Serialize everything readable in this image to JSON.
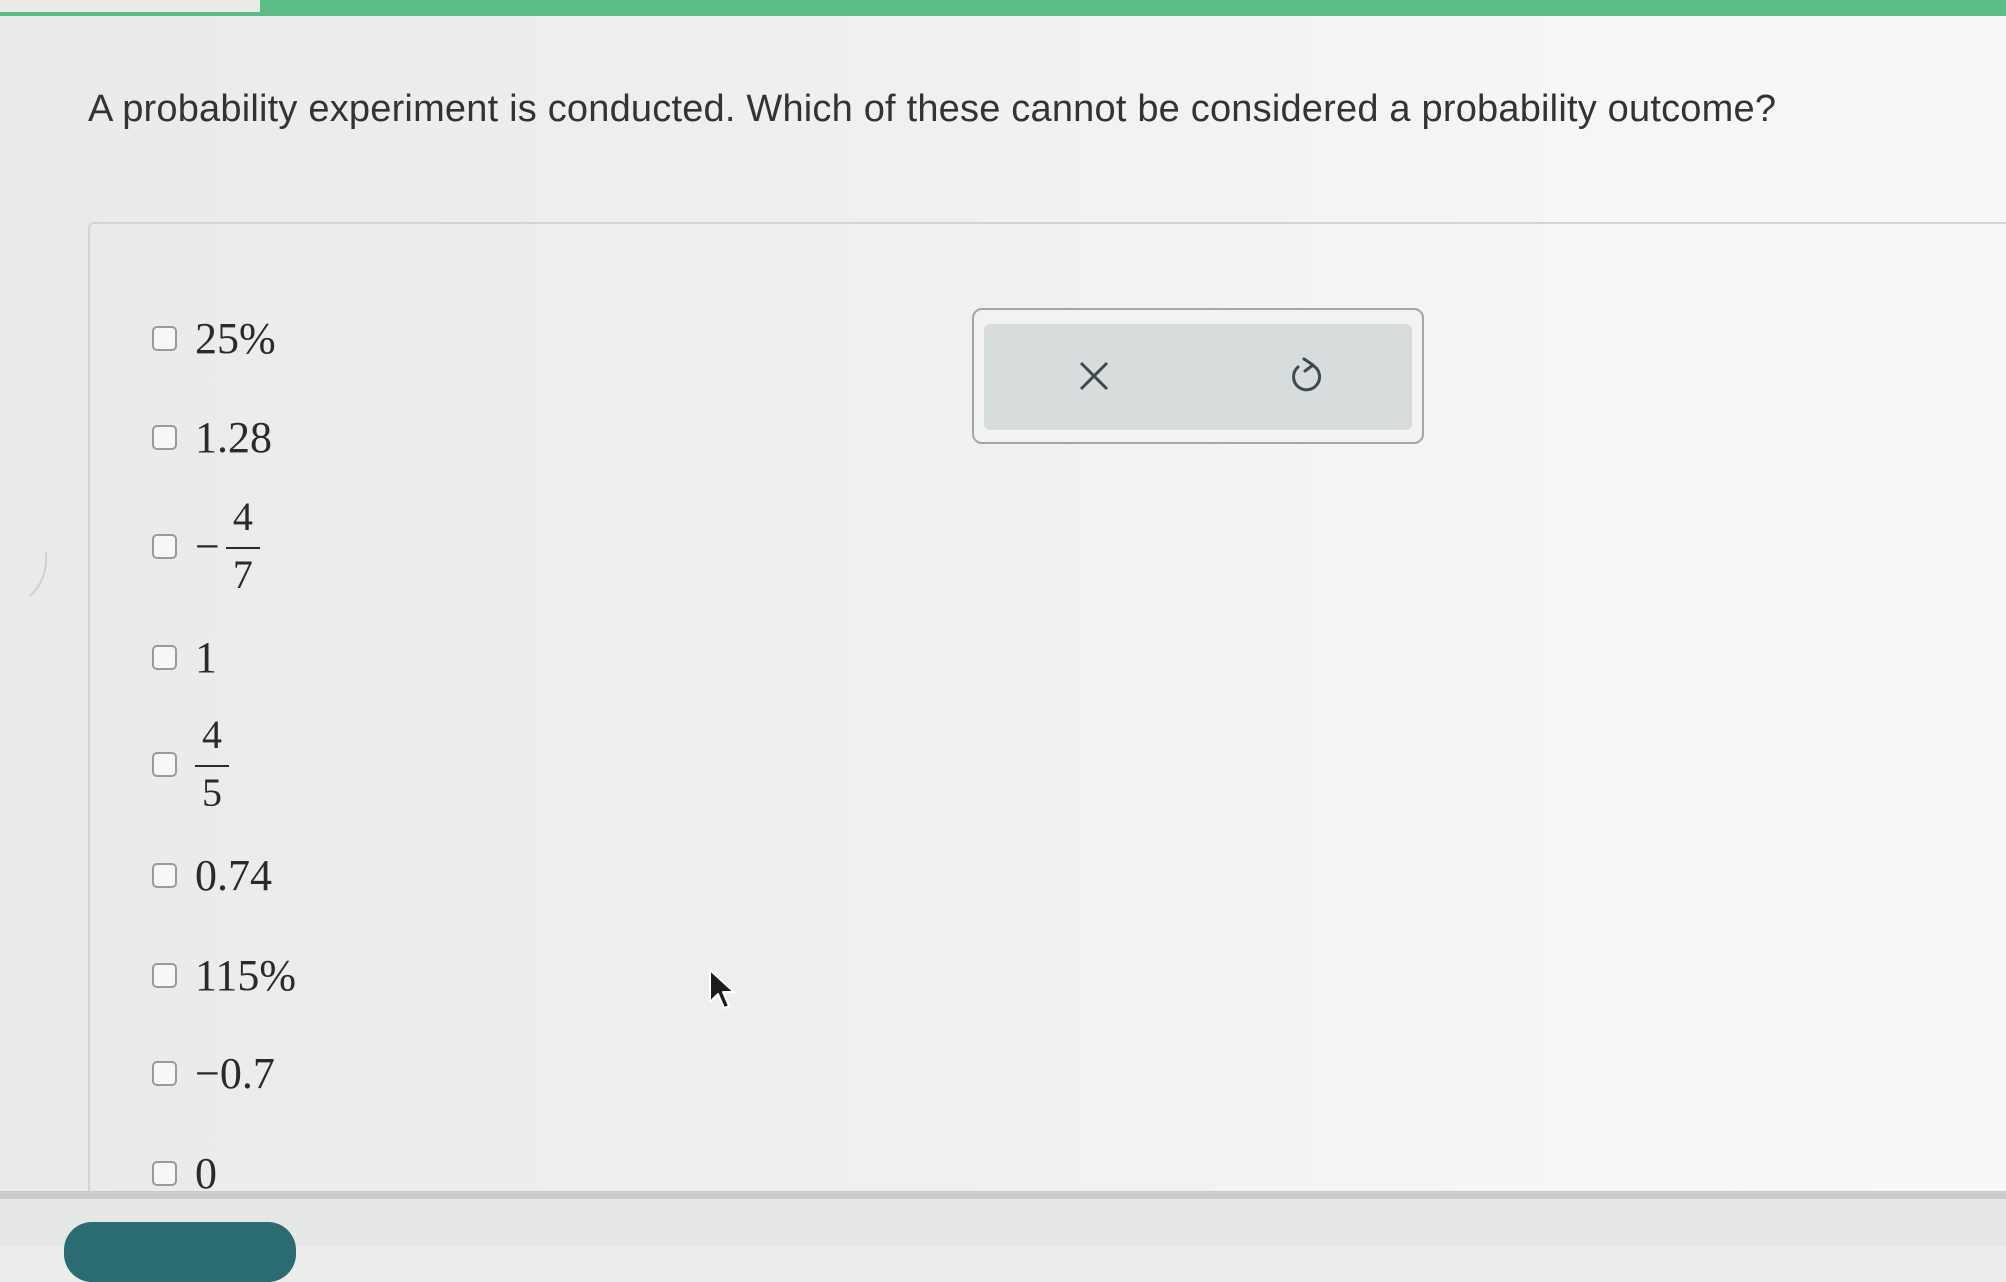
{
  "question": {
    "text": "A probability experiment is conducted. Which of these cannot be considered a probability outcome?"
  },
  "choices": [
    {
      "label": "25%",
      "checked": false
    },
    {
      "label": "1.28",
      "checked": false
    },
    {
      "sign": "−",
      "numerator": "4",
      "denominator": "7",
      "checked": false
    },
    {
      "label": "1",
      "checked": false
    },
    {
      "sign": "",
      "numerator": "4",
      "denominator": "5",
      "checked": false
    },
    {
      "label": "0.74",
      "checked": false
    },
    {
      "label": "115%",
      "checked": false
    },
    {
      "label": "−0.7",
      "checked": false
    },
    {
      "label": "0",
      "checked": false
    }
  ],
  "toolbar": {
    "clear_icon": "close-icon",
    "undo_icon": "undo-icon"
  },
  "colors": {
    "accent_green": "#5cbc85",
    "button_teal": "#2b6b72",
    "toolbar_bg": "#d7dcdc"
  }
}
